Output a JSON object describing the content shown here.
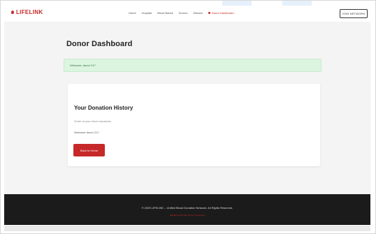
{
  "brand": {
    "name": "LIFELINK",
    "accent_color": "#c62828"
  },
  "nav": {
    "links": [
      {
        "label": "Home"
      },
      {
        "label": "Hospital"
      },
      {
        "label": "Blood Banks"
      },
      {
        "label": "Donors"
      },
      {
        "label": "Mission"
      }
    ],
    "active_label": "Donor Dashboard",
    "join_label": "JOIN NETWORK"
  },
  "main": {
    "title": "Donor Dashboard",
    "welcome": "Welcome, donor 217",
    "welcome_color": "#dcf5e0"
  },
  "card": {
    "title": "Your Donation History",
    "line1": "Order of your blood donations",
    "line2": "Welcome donor 217",
    "back_button": "Back to Home"
  },
  "footer": {
    "text": "© 2025 LIFELINK – Unified Blood Donation Network. All Rights Reserved.",
    "sub": "Designed with care for our community"
  }
}
